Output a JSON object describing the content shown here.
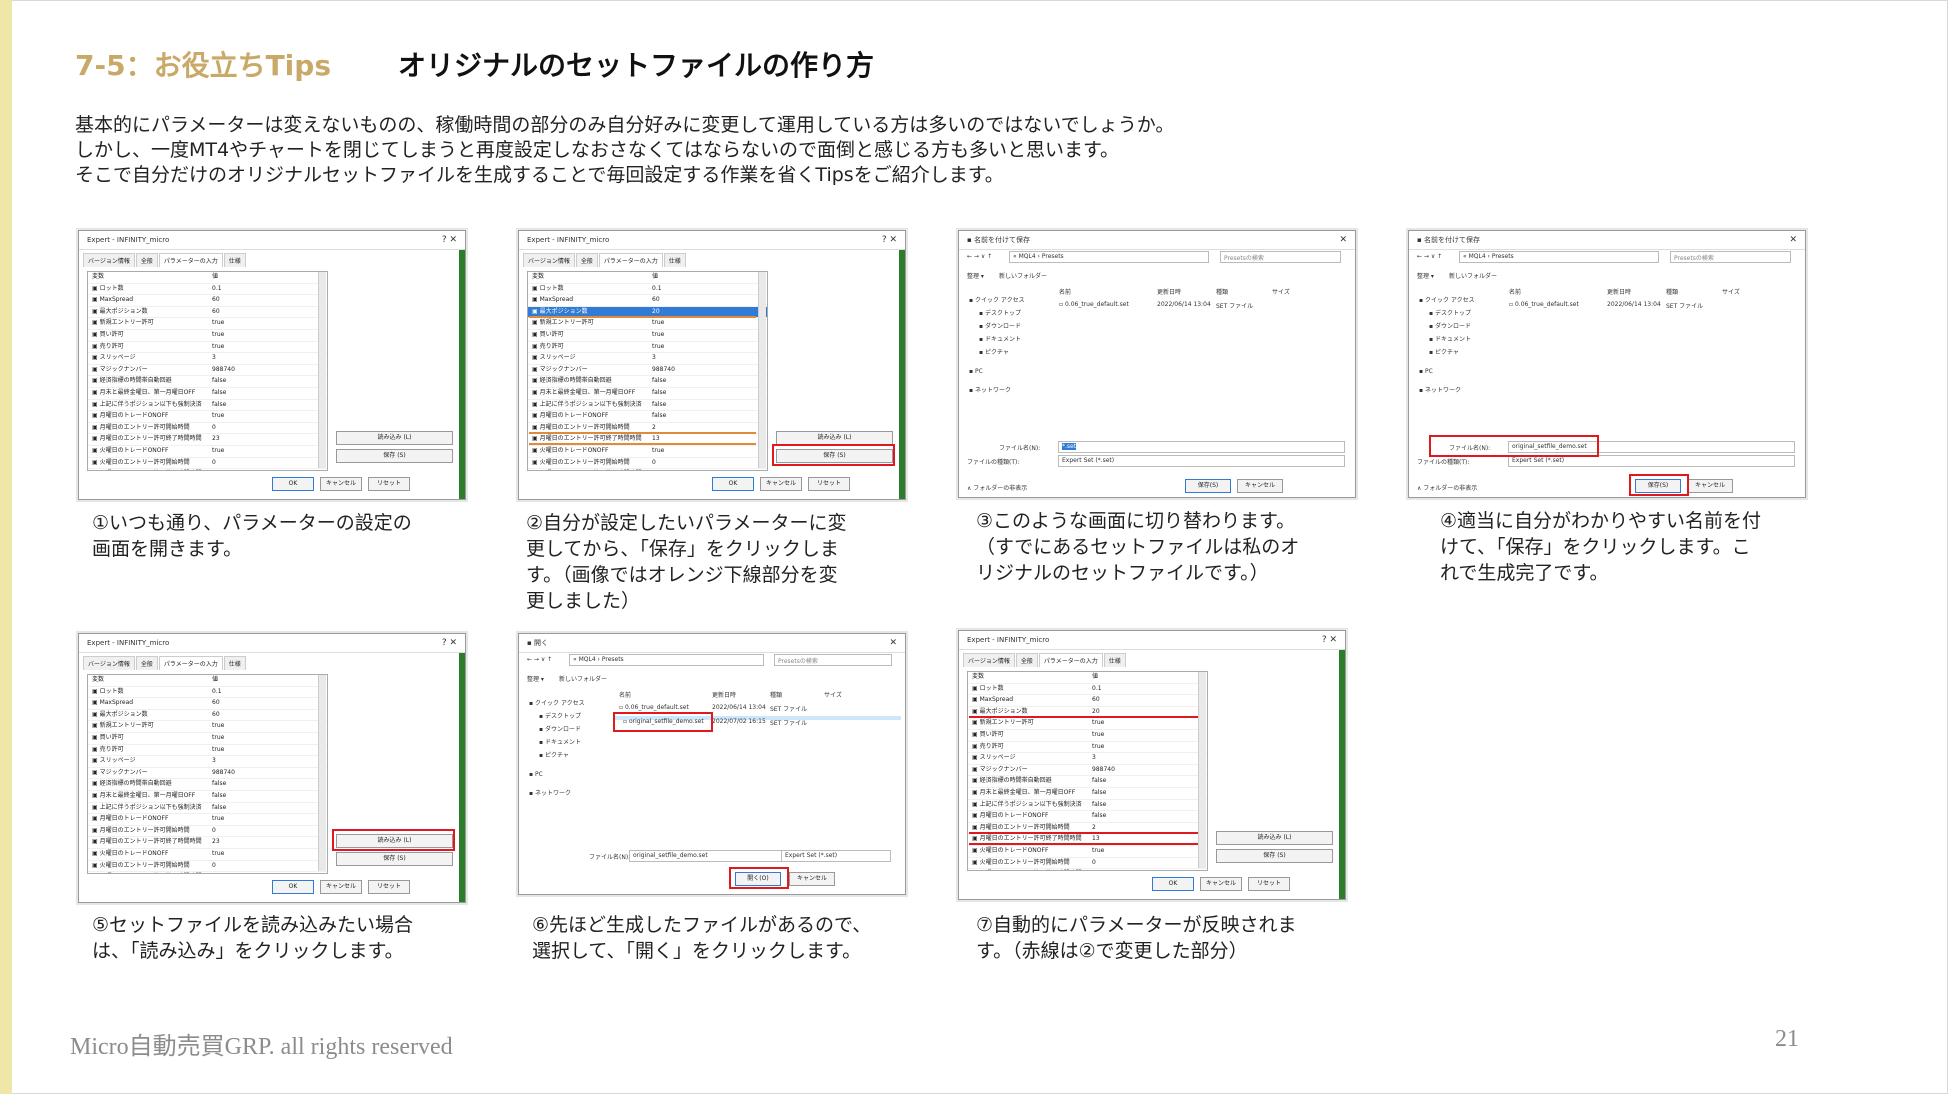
{
  "header": {
    "section": "7-5：お役立ちTips",
    "title": "オリジナルのセットファイルの作り方"
  },
  "intro": [
    "基本的にパラメーターは変えないものの、稼働時間の部分のみ自分好みに変更して運用している方は多いのではないでしょうか。",
    "しかし、一度MT4やチャートを閉じてしまうと再度設定しなおさなくてはならないので面倒と感じる方も多いと思います。",
    "そこで自分だけのオリジナルセットファイルを生成することで毎回設定する作業を省くTipsをご紹介します。"
  ],
  "steps": [
    {
      "caption": [
        "①いつも通り、パラメーターの設定の",
        "画面を開きます。"
      ]
    },
    {
      "caption": [
        "②自分が設定したいパラメーターに変",
        "更してから、「保存」をクリックしま",
        "す。（画像ではオレンジ下線部分を変",
        "更しました）"
      ]
    },
    {
      "caption": [
        "③このような画面に切り替わります。",
        "（すでにあるセットファイルは私のオ",
        "リジナルのセットファイルです。）"
      ]
    },
    {
      "caption": [
        "④適当に自分がわかりやすい名前を付",
        "けて、「保存」をクリックします。こ",
        "れで生成完了です。"
      ]
    },
    {
      "caption": [
        "⑤セットファイルを読み込みたい場合",
        "は、「読み込み」をクリックします。"
      ]
    },
    {
      "caption": [
        "⑥先ほど生成したファイルがあるので、",
        "選択して、「開く」をクリックします。"
      ]
    },
    {
      "caption": [
        "⑦自動的にパラメーターが反映されま",
        "す。（赤線は②で変更した部分）"
      ]
    }
  ],
  "expert_dialog": {
    "title": "Expert - INFINITY_micro",
    "controls": "?    ✕",
    "tabs": [
      "バージョン情報",
      "全般",
      "パラメーターの入力",
      "仕様"
    ],
    "col_var": "変数",
    "col_val": "値",
    "params": [
      [
        "ロット数",
        "0.1"
      ],
      [
        "MaxSpread",
        "60"
      ],
      [
        "最大ポジション数",
        "60"
      ],
      [
        "新規エントリー許可",
        "true"
      ],
      [
        "買い許可",
        "true"
      ],
      [
        "売り許可",
        "true"
      ],
      [
        "スリッページ",
        "3"
      ],
      [
        "マジックナンバー",
        "988740"
      ],
      [
        "経済指標の時間帯自動回避",
        "false"
      ],
      [
        "月末と最終金曜日、第一月曜日OFF",
        "false"
      ],
      [
        "上記に伴うポジション以下も強制決済",
        "false"
      ],
      [
        "月曜日のトレードONOFF",
        "true"
      ],
      [
        "月曜日のエントリー許可開始時間",
        "0"
      ],
      [
        "月曜日のエントリー許可終了時間時間",
        "23"
      ],
      [
        "火曜日のトレードONOFF",
        "true"
      ],
      [
        "火曜日のエントリー許可開始時間",
        "0"
      ],
      [
        "火曜日のエントリー許可終了時間時間",
        "23"
      ]
    ],
    "params_changed": [
      [
        "ロット数",
        "0.1"
      ],
      [
        "MaxSpread",
        "60"
      ],
      [
        "最大ポジション数",
        "20"
      ],
      [
        "新規エントリー許可",
        "true"
      ],
      [
        "買い許可",
        "true"
      ],
      [
        "売り許可",
        "true"
      ],
      [
        "スリッページ",
        "3"
      ],
      [
        "マジックナンバー",
        "988740"
      ],
      [
        "経済指標の時間帯自動回避",
        "false"
      ],
      [
        "月末と最終金曜日、第一月曜日OFF",
        "false"
      ],
      [
        "上記に伴うポジション以下も強制決済",
        "false"
      ],
      [
        "月曜日のトレードONOFF",
        "false"
      ],
      [
        "月曜日のエントリー許可開始時間",
        "2"
      ],
      [
        "月曜日のエントリー許可終了時間時間",
        "13"
      ],
      [
        "火曜日のトレードONOFF",
        "true"
      ],
      [
        "火曜日のエントリー許可開始時間",
        "0"
      ],
      [
        "火曜日のエントリー許可終了時間時間",
        "23"
      ]
    ],
    "load_button": "読み込み (L)",
    "save_button": "保存 (S)",
    "ok_button": "OK",
    "cancel_button": "キャンセル",
    "reset_button": "リセット"
  },
  "save_dialog": {
    "title": "名前を付けて保存",
    "path": "«  MQL4  ›  Presets",
    "search_placeholder": "Presetsの検索",
    "organize": "整理 ▾",
    "new_folder": "新しいフォルダー",
    "sidebar": [
      "クイック アクセス",
      "デスクトップ",
      "ダウンロード",
      "ドキュメント",
      "ピクチャ",
      "PC",
      "ネットワーク"
    ],
    "col_name": "名前",
    "col_date": "更新日時",
    "col_type": "種類",
    "col_size": "サイズ",
    "file_name": "0.06_true_default.set",
    "file_date": "2022/06/14 13:04",
    "file_type": "SET ファイル",
    "filename_label": "ファイル名(N):",
    "filetype_label": "ファイルの種類(T):",
    "filetype_value": "Expert Set (*.set)",
    "hide_folders": "フォルダーの非表示",
    "save_button": "保存(S)",
    "cancel_button": "キャンセル",
    "default_filename": "*.set",
    "new_filename": "original_setfile_demo.set"
  },
  "open_dialog": {
    "title": "開く",
    "path": "«  MQL4  ›  Presets",
    "search_placeholder": "Presetsの検索",
    "organize": "整理 ▾",
    "new_folder": "新しいフォルダー",
    "sidebar": [
      "クイック アクセス",
      "デスクトップ",
      "ダウンロード",
      "ドキュメント",
      "ピクチャ",
      "PC",
      "ネットワーク"
    ],
    "col_name": "名前",
    "col_date": "更新日時",
    "col_type": "種類",
    "col_size": "サイズ",
    "file1_name": "0.06_true_default.set",
    "file1_date": "2022/06/14 13:04",
    "file1_type": "SET ファイル",
    "file2_name": "original_setfile_demo.set",
    "file2_date": "2022/07/02 16:15",
    "file2_type": "SET ファイル",
    "filename_label": "ファイル名(N):",
    "filename_value": "original_setfile_demo.set",
    "filetype_value": "Expert Set (*.set)",
    "open_button": "開く(O)",
    "cancel_button": "キャンセル"
  },
  "footer": {
    "copyright": "Micro自動売買GRP. all rights reserved",
    "page": "21"
  }
}
